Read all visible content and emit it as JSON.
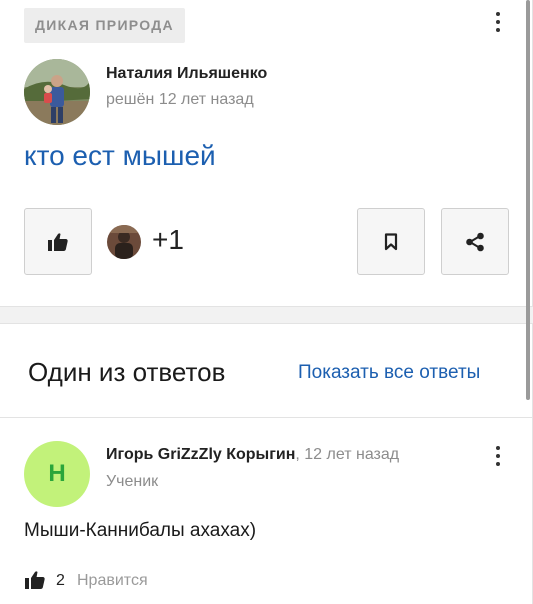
{
  "question": {
    "category": "ДИКАЯ ПРИРОДА",
    "author": {
      "name": "Наталия Ильяшенко",
      "meta": "решён 12 лет назад"
    },
    "title": "кто ест мышей",
    "likes": {
      "count_label": "+1"
    }
  },
  "answers": {
    "header": "Один из ответов",
    "show_all": "Показать все ответы",
    "item": {
      "avatar_letter": "Н",
      "author": "Игорь GriZzZly Корыгин",
      "time": ", 12 лет назад",
      "role": "Ученик",
      "text": "Мыши-Каннибалы ахахах)",
      "likes": "2",
      "like_label": "Нравится"
    }
  },
  "icons": [
    "thumb-up-icon",
    "bookmark-icon",
    "share-icon",
    "more-vertical-icon"
  ],
  "colors": {
    "link": "#1c5fb0",
    "avatar_bg": "#c2f27a",
    "avatar_letter": "#2aa63a"
  }
}
